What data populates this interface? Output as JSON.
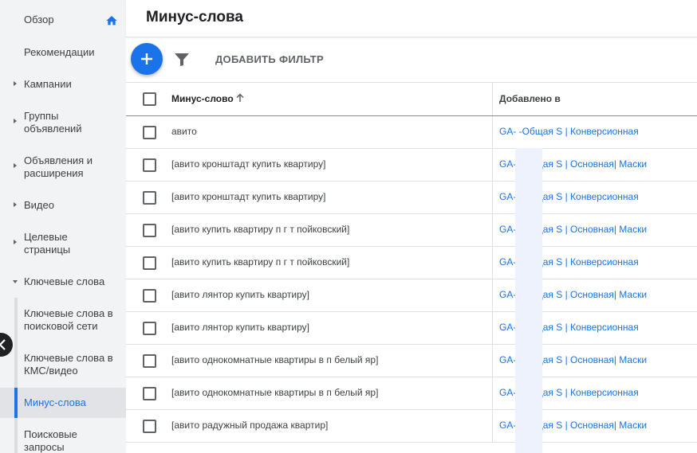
{
  "sidebar": {
    "items": [
      {
        "label": "Обзор"
      },
      {
        "label": "Рекомендации"
      },
      {
        "label": "Кампании"
      },
      {
        "label": "Группы объявлений"
      },
      {
        "label": "Объявления и расширения"
      },
      {
        "label": "Видео"
      },
      {
        "label": "Целевые страницы"
      },
      {
        "label": "Ключевые слова"
      }
    ],
    "subitems": [
      {
        "label": "Ключевые слова в поисковой сети"
      },
      {
        "label": "Ключевые слова в КМС/видео"
      },
      {
        "label": "Минус-слова"
      },
      {
        "label": "Поисковые запросы"
      }
    ],
    "active_color": "#1a73e8"
  },
  "header": {
    "title": "Минус-слова"
  },
  "toolbar": {
    "add_filter_label": "ДОБАВИТЬ ФИЛЬТР"
  },
  "table": {
    "columns": {
      "keyword": "Минус-слово",
      "added_to": "Добавлено в"
    },
    "rows": [
      {
        "keyword": "авито",
        "added_to": "GA-          -Общая S | Конверсионная"
      },
      {
        "keyword": "[авито кронштадт купить квартиру]",
        "added_to": "GA-          -Общая S | Основная| Маски"
      },
      {
        "keyword": "[авито кронштадт купить квартиру]",
        "added_to": "GA-          -Общая S | Конверсионная"
      },
      {
        "keyword": "[авито купить квартиру п г т пойковский]",
        "added_to": "GA-          -Общая S | Основная| Маски"
      },
      {
        "keyword": "[авито купить квартиру п г т пойковский]",
        "added_to": "GA-          -Общая S | Конверсионная"
      },
      {
        "keyword": "[авито лянтор купить квартиру]",
        "added_to": "GA-          -Общая S | Основная| Маски"
      },
      {
        "keyword": "[авито лянтор купить квартиру]",
        "added_to": "GA-          -Общая S | Конверсионная"
      },
      {
        "keyword": "[авито однокомнатные квартиры в п белый яр]",
        "added_to": "GA-          -Общая S | Основная| Маски"
      },
      {
        "keyword": "[авито однокомнатные квартиры в п белый яр]",
        "added_to": "GA-          -Общая S | Конверсионная"
      },
      {
        "keyword": "[авито радужный продажа квартир]",
        "added_to": "GA-          -Общая S | Основная| Маски"
      }
    ]
  },
  "icons": {
    "home": "home-icon",
    "add": "plus-icon",
    "filter": "filter-icon",
    "sort": "arrow-up-icon",
    "collapse": "chevron-left-icon"
  },
  "colors": {
    "accent": "#1a73e8",
    "sidebar_bg": "#f1f3f4"
  }
}
